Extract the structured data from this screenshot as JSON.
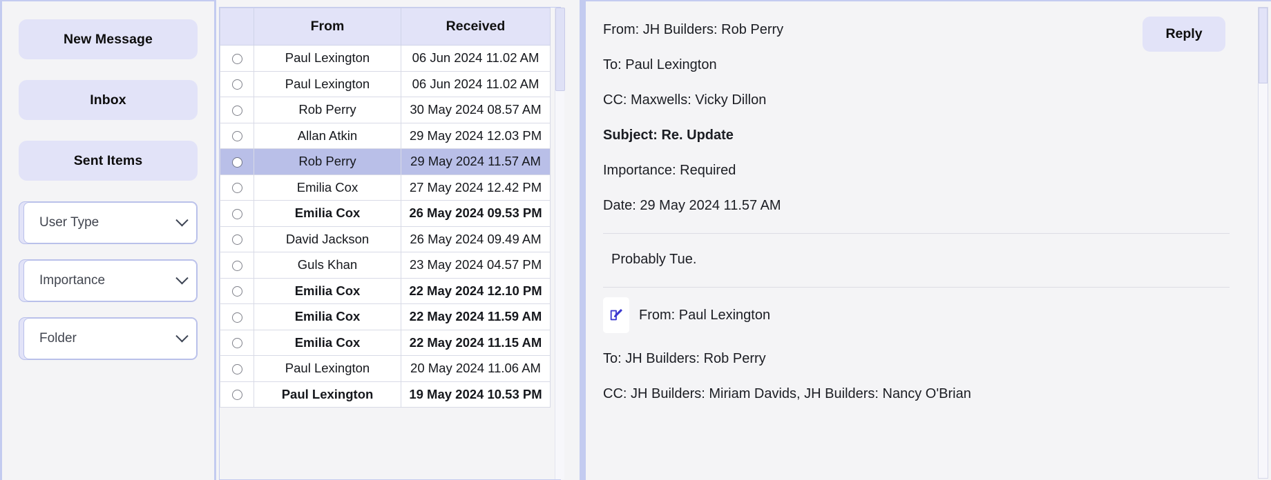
{
  "sidebar": {
    "buttons": [
      {
        "label": "New Message",
        "name": "new-message-button"
      },
      {
        "label": "Inbox",
        "name": "sidebar-item-inbox"
      },
      {
        "label": "Sent Items",
        "name": "sidebar-item-sent-items"
      }
    ],
    "filters": [
      {
        "label": "User Type",
        "name": "filter-user-type"
      },
      {
        "label": "Importance",
        "name": "filter-importance"
      },
      {
        "label": "Folder",
        "name": "filter-folder"
      }
    ]
  },
  "mail_list": {
    "columns": [
      "",
      "From",
      "Received"
    ],
    "rows": [
      {
        "from": "Paul Lexington",
        "received": "06 Jun 2024 11.02 AM",
        "unread": false,
        "selected": false
      },
      {
        "from": "Paul Lexington",
        "received": "06 Jun 2024 11.02 AM",
        "unread": false,
        "selected": false
      },
      {
        "from": "Rob Perry",
        "received": "30 May 2024 08.57 AM",
        "unread": false,
        "selected": false
      },
      {
        "from": "Allan Atkin",
        "received": "29 May 2024 12.03 PM",
        "unread": false,
        "selected": false
      },
      {
        "from": "Rob Perry",
        "received": "29 May 2024 11.57 AM",
        "unread": false,
        "selected": true
      },
      {
        "from": "Emilia Cox",
        "received": "27 May 2024 12.42 PM",
        "unread": false,
        "selected": false
      },
      {
        "from": "Emilia Cox",
        "received": "26 May 2024 09.53 PM",
        "unread": true,
        "selected": false
      },
      {
        "from": "David Jackson",
        "received": "26 May 2024 09.49 AM",
        "unread": false,
        "selected": false
      },
      {
        "from": "Guls Khan",
        "received": "23 May 2024 04.57 PM",
        "unread": false,
        "selected": false
      },
      {
        "from": "Emilia Cox",
        "received": "22 May 2024 12.10 PM",
        "unread": true,
        "selected": false
      },
      {
        "from": "Emilia Cox",
        "received": "22 May 2024 11.59 AM",
        "unread": true,
        "selected": false
      },
      {
        "from": "Emilia Cox",
        "received": "22 May 2024 11.15 AM",
        "unread": true,
        "selected": false
      },
      {
        "from": "Paul Lexington",
        "received": "20 May 2024 11.06 AM",
        "unread": false,
        "selected": false
      },
      {
        "from": "Paul Lexington",
        "received": "19 May 2024 10.53 PM",
        "unread": true,
        "selected": false
      }
    ]
  },
  "reader": {
    "reply_label": "Reply",
    "from": "From: JH Builders: Rob Perry",
    "to": "To: Paul Lexington",
    "cc": "CC: Maxwells: Vicky Dillon",
    "subject": "Subject: Re. Update",
    "importance": "Importance: Required",
    "date": "Date: 29 May 2024 11.57 AM",
    "body": "Probably Tue.",
    "quoted": {
      "from": "From: Paul Lexington",
      "to": "To: JH Builders: Rob Perry",
      "cc": "CC: JH Builders: Miriam Davids, JH Builders: Nancy O'Brian"
    }
  },
  "colors": {
    "accent": "#e2e3f8",
    "border": "#c3cbf0",
    "selected_row": "#b9bfe8",
    "icon": "#3b38d0",
    "page_bg": "#f4f4f6"
  }
}
